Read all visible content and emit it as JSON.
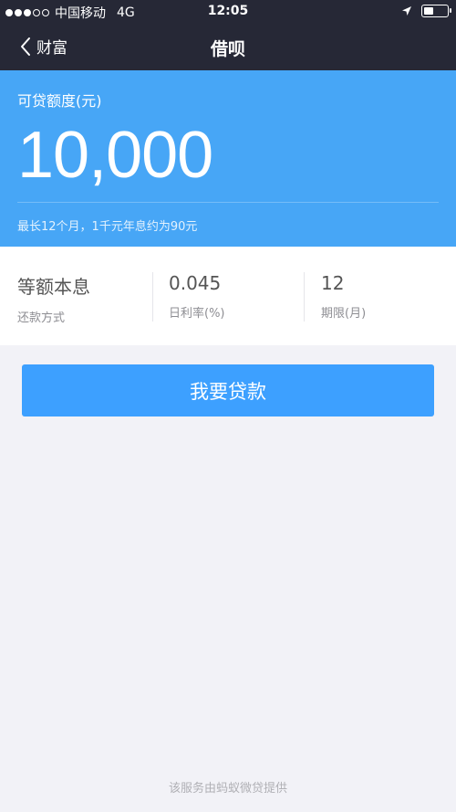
{
  "status_bar": {
    "carrier": "中国移动",
    "network": "4G",
    "time": "12:05",
    "signal_bars_filled": 3,
    "signal_bars_total": 5,
    "icons": [
      "location-arrow-icon",
      "battery-icon"
    ],
    "battery_level": 0.4
  },
  "nav": {
    "back_label": "财富",
    "title": "借呗"
  },
  "hero": {
    "label": "可贷额度(元)",
    "amount": "10,000",
    "note": "最长12个月，1千元年息约为90元",
    "background_color": "#47a6f6"
  },
  "info": [
    {
      "value": "等额本息",
      "caption": "还款方式"
    },
    {
      "value": "0.045",
      "caption": "日利率(%)"
    },
    {
      "value": "12",
      "caption": "期限(月)"
    }
  ],
  "cta": {
    "label": "我要贷款",
    "color": "#3da0ff"
  },
  "footer": {
    "text": "该服务由蚂蚁微贷提供"
  }
}
